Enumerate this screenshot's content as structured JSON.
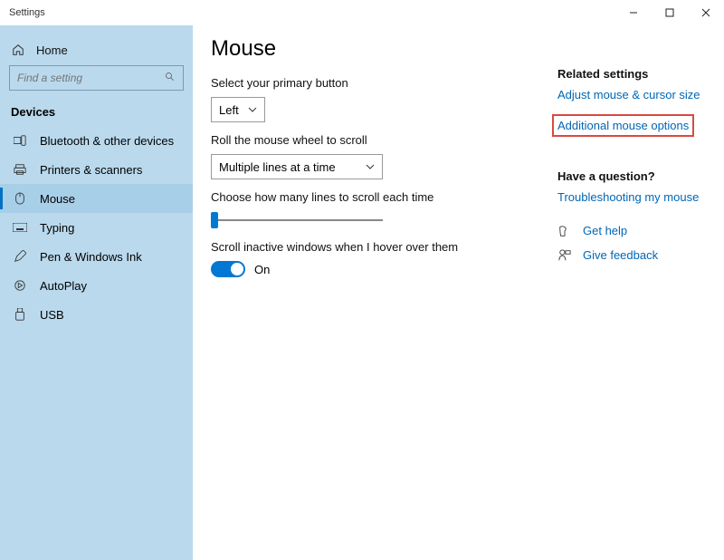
{
  "window": {
    "title": "Settings"
  },
  "sidebar": {
    "home_label": "Home",
    "search_placeholder": "Find a setting",
    "section_title": "Devices",
    "items": [
      {
        "label": "Bluetooth & other devices"
      },
      {
        "label": "Printers & scanners"
      },
      {
        "label": "Mouse"
      },
      {
        "label": "Typing"
      },
      {
        "label": "Pen & Windows Ink"
      },
      {
        "label": "AutoPlay"
      },
      {
        "label": "USB"
      }
    ]
  },
  "page": {
    "heading": "Mouse",
    "primary_label": "Select your primary button",
    "primary_value": "Left",
    "scroll_mode_label": "Roll the mouse wheel to scroll",
    "scroll_mode_value": "Multiple lines at a time",
    "lines_label": "Choose how many lines to scroll each time",
    "inactive_label": "Scroll inactive windows when I hover over them",
    "toggle_state": "On"
  },
  "right": {
    "related_heading": "Related settings",
    "link_cursor": "Adjust mouse & cursor size",
    "link_additional": "Additional mouse options",
    "question_heading": "Have a question?",
    "link_troubleshoot": "Troubleshooting my mouse",
    "help_label": "Get help",
    "feedback_label": "Give feedback"
  }
}
